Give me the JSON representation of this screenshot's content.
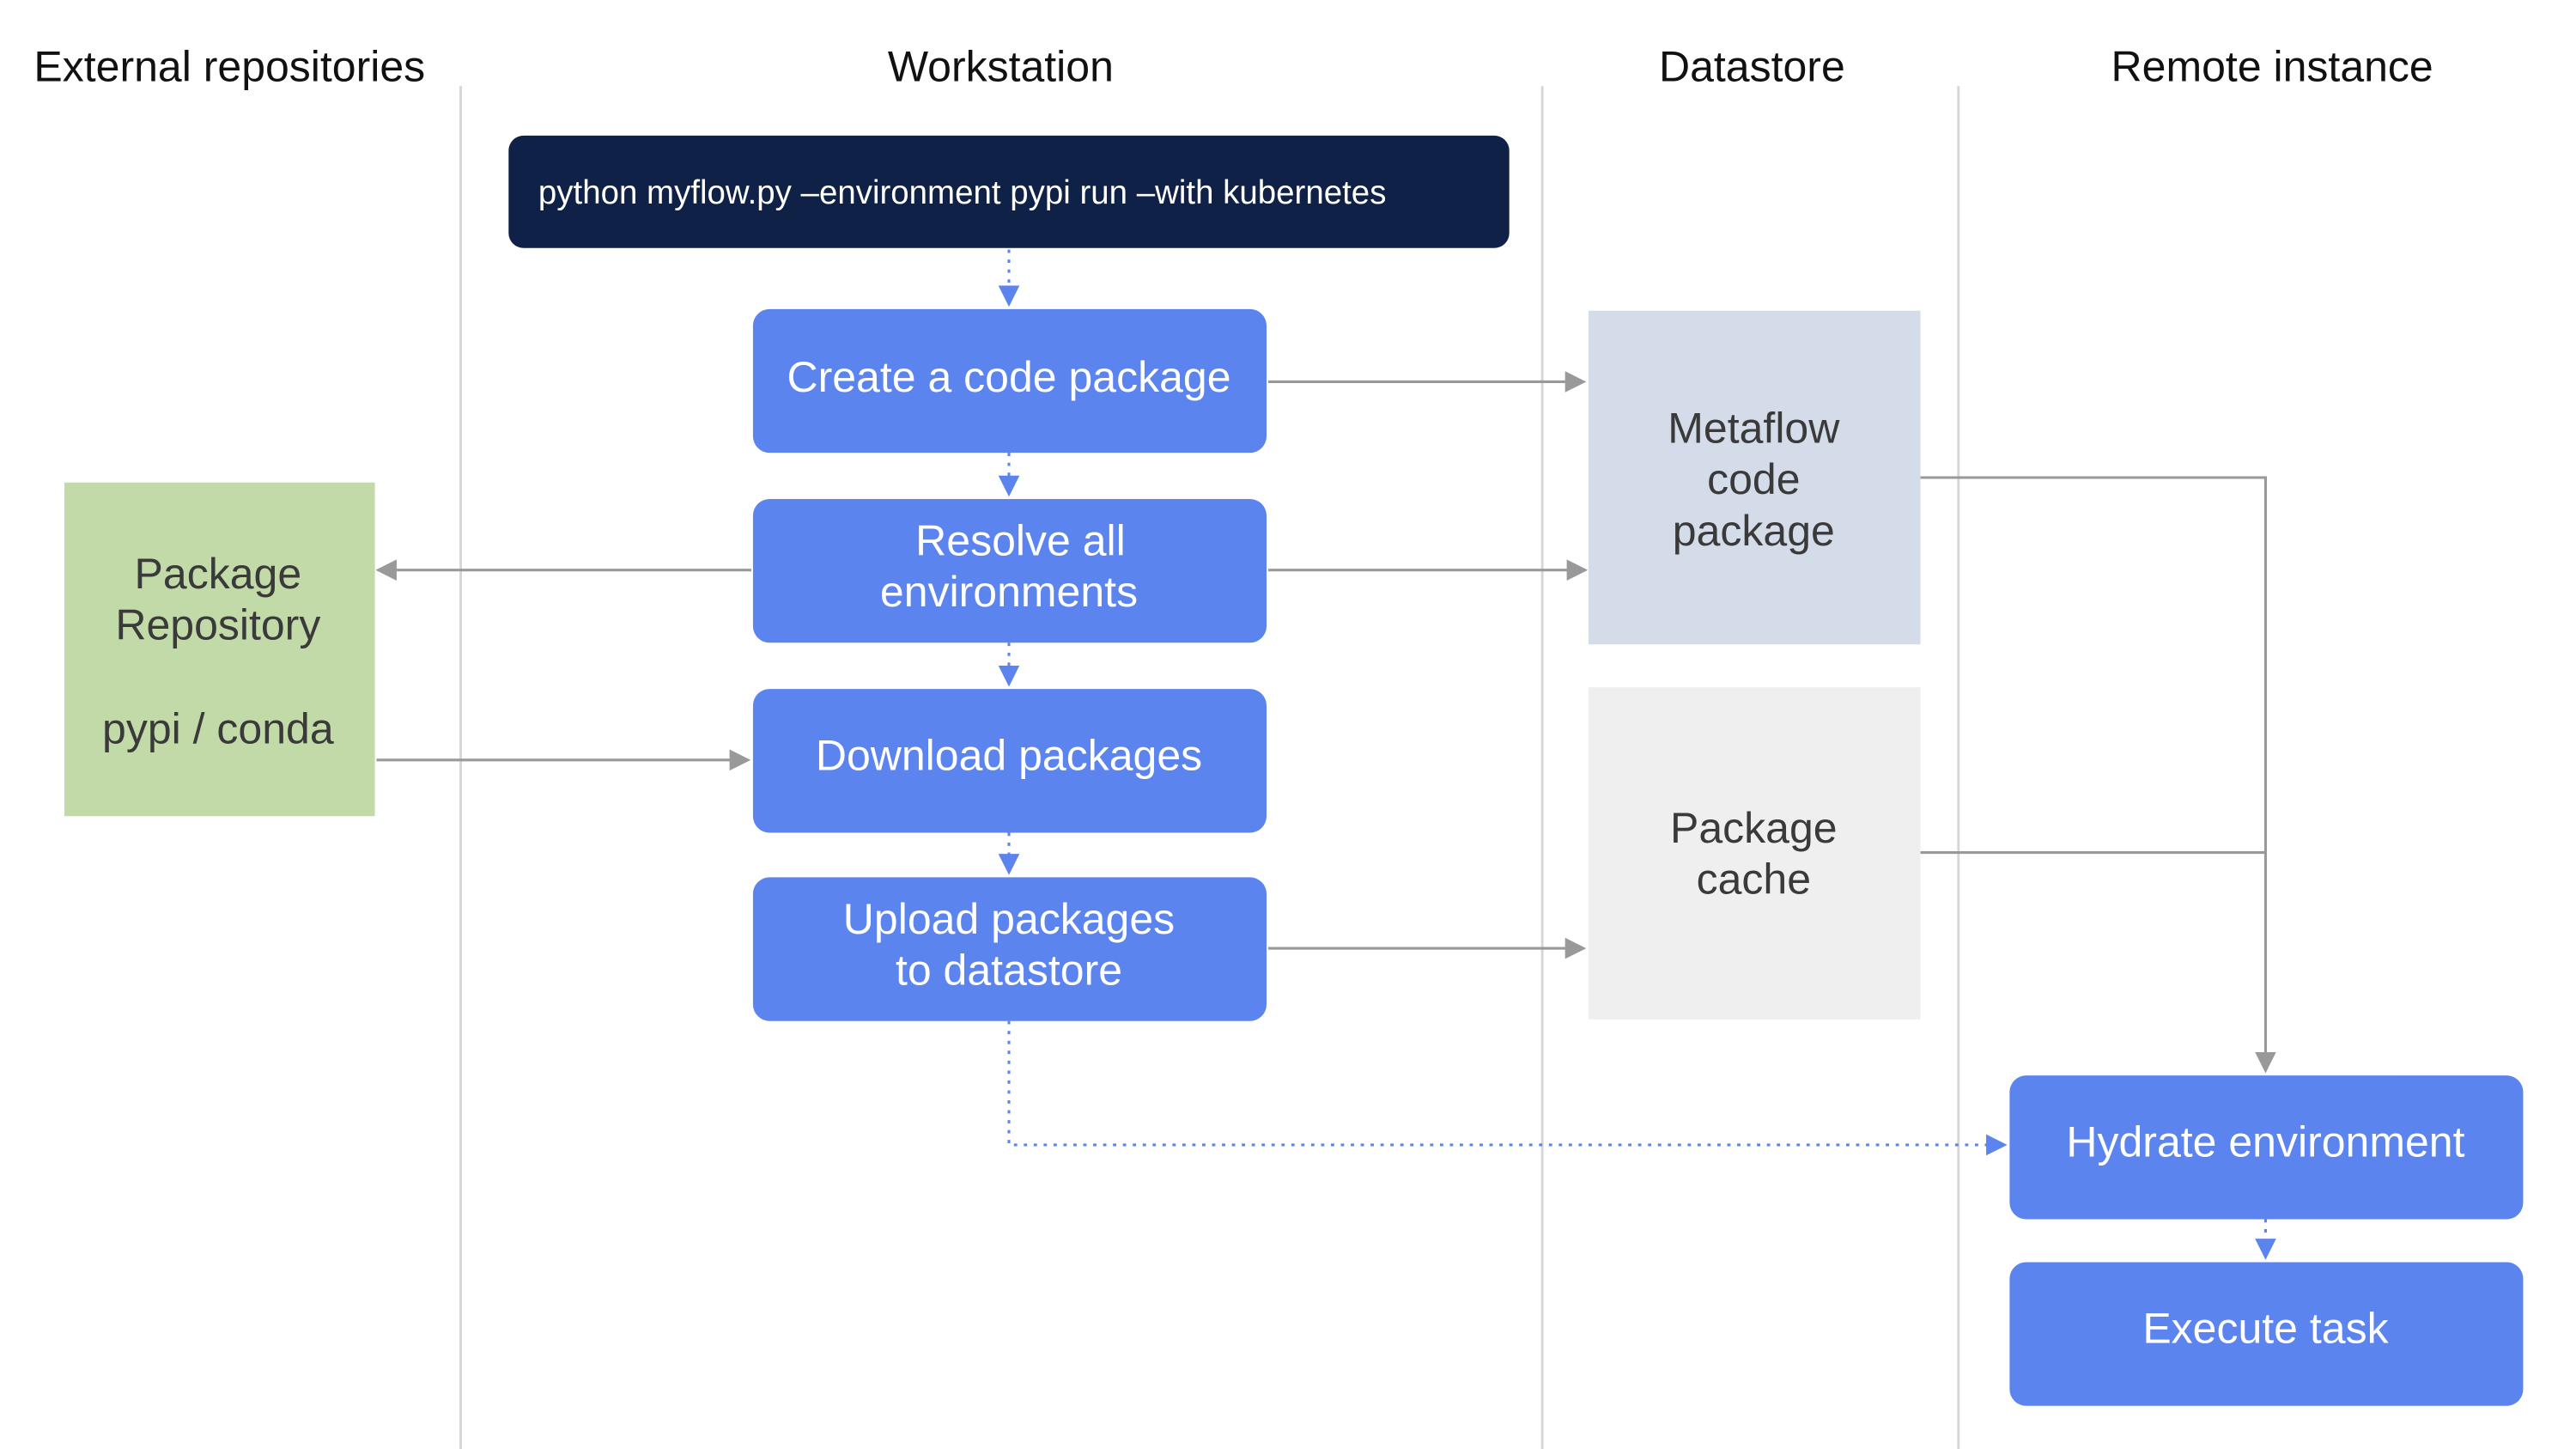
{
  "lanes": [
    "External repositories",
    "Workstation",
    "Datastore",
    "Remote instance"
  ],
  "command": "python myflow.py –environment pypi run –with kubernetes",
  "workstation_steps": [
    [
      "Create a code package"
    ],
    [
      "Resolve all",
      "environments"
    ],
    [
      "Download packages"
    ],
    [
      "Upload packages",
      "to datastore"
    ]
  ],
  "repository": {
    "lines": [
      "Package",
      "Repository",
      "pypi / conda"
    ]
  },
  "datastore": {
    "code_package": [
      "Metaflow",
      "code",
      "package"
    ],
    "package_cache": [
      "Package",
      "cache"
    ]
  },
  "remote_steps": [
    "Hydrate environment",
    "Execute task"
  ],
  "colors": {
    "command_bg": "#0f2147",
    "step_bg": "#5b84ee",
    "repository_bg": "#c2d9a8",
    "code_package_bg": "#d4dbe9",
    "package_cache_bg": "#efefef",
    "arrow": "#999999"
  }
}
